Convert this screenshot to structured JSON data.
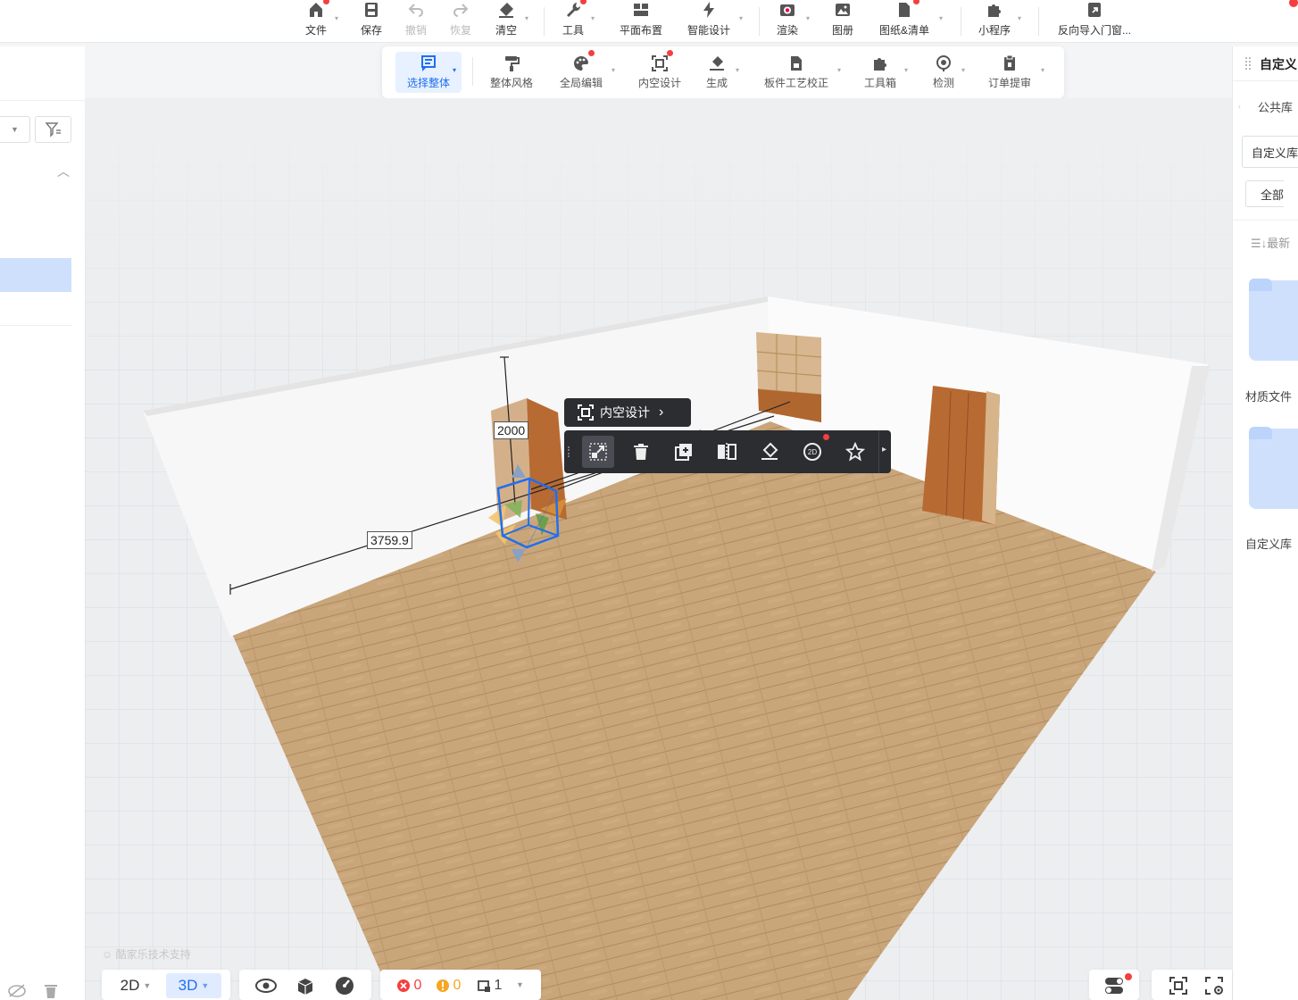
{
  "topbar": {
    "items": [
      {
        "label": "文件",
        "icon": "home-icon"
      },
      {
        "label": "保存",
        "icon": "save-icon"
      },
      {
        "label": "撤销",
        "icon": "undo-icon"
      },
      {
        "label": "恢复",
        "icon": "redo-icon"
      },
      {
        "label": "清空",
        "icon": "eraser-icon"
      },
      {
        "label": "工具",
        "icon": "wrench-icon"
      },
      {
        "label": "平面布置",
        "icon": "floorplan-icon"
      },
      {
        "label": "智能设计",
        "icon": "lightning-icon"
      },
      {
        "label": "渲染",
        "icon": "camera-icon"
      },
      {
        "label": "图册",
        "icon": "album-icon"
      },
      {
        "label": "图纸&清单",
        "icon": "document-icon"
      },
      {
        "label": "小程序",
        "icon": "puzzle-icon"
      },
      {
        "label": "反向导入门窗...",
        "icon": "import-icon"
      }
    ]
  },
  "subbar": {
    "items": [
      {
        "label": "选择整体",
        "icon": "select-all-icon"
      },
      {
        "label": "整体风格",
        "icon": "paint-roller-icon"
      },
      {
        "label": "全局编辑",
        "icon": "palette-icon"
      },
      {
        "label": "内空设计",
        "icon": "inner-space-icon"
      },
      {
        "label": "生成",
        "icon": "generate-icon"
      },
      {
        "label": "板件工艺校正",
        "icon": "board-icon"
      },
      {
        "label": "工具箱",
        "icon": "toolbox-icon"
      },
      {
        "label": "检测",
        "icon": "detect-icon"
      },
      {
        "label": "订单提审",
        "icon": "order-icon"
      }
    ]
  },
  "rightpanel": {
    "title": "自定义",
    "tab": "公共库",
    "library_select": "自定义库",
    "filter_select": "全部",
    "sort_label": "最新",
    "folders": [
      "材质文件",
      "自定义库"
    ]
  },
  "scene": {
    "pill_label": "内空设计",
    "dim_height": "2000",
    "dim_width": "3759.9",
    "watermark": "酷家乐技术支持"
  },
  "bottom": {
    "view_2d": "2D",
    "view_3d": "3D",
    "errors": "0",
    "warnings": "0",
    "items": "1"
  },
  "colors": {
    "accent": "#1f6ff0",
    "error": "#f53f3f",
    "warning": "#f5a623",
    "floor": "#c9a57a",
    "cabinet": "#b86a33"
  }
}
